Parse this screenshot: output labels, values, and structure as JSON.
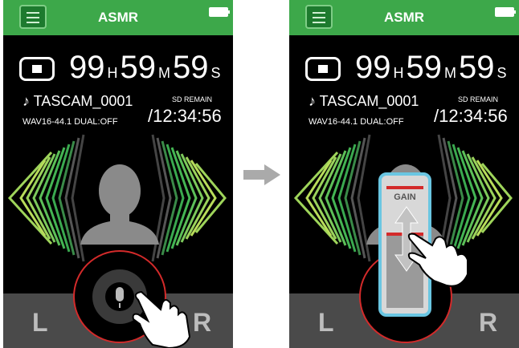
{
  "title": "ASMR",
  "time": {
    "hours": "99",
    "hours_unit": "H",
    "minutes": "59",
    "minutes_unit": "M",
    "seconds": "59",
    "seconds_unit": "S"
  },
  "file": {
    "name": "♪ TASCAM_0001",
    "format": "WAV16-44.1  DUAL:OFF"
  },
  "remain": {
    "label": "SD REMAIN",
    "value": "/12:34:56"
  },
  "channels": {
    "left": "L",
    "right": "R"
  },
  "gain_label": "GAIN",
  "colors": {
    "header": "#3da84a",
    "wave_outer": "#3db052",
    "wave_inner": "#a7d45a",
    "ring": "#d32a2a",
    "gain_frame": "#6ac6e2",
    "background": "#000000"
  }
}
